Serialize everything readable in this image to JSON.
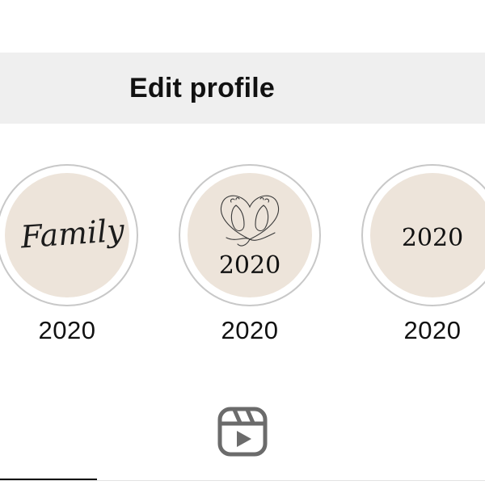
{
  "header": {
    "edit_profile_label": "Edit profile"
  },
  "highlights": [
    {
      "cover_text": "Family",
      "label": "2020"
    },
    {
      "cover_text": "2020",
      "label": "2020"
    },
    {
      "cover_text": "2020",
      "label": "2020"
    }
  ],
  "colors": {
    "cover_background": "#ede4da",
    "ring": "#c8c8c8",
    "edit_bar": "#efefef"
  },
  "icons": {
    "reels_tab": "reels-icon",
    "feet_heart": "baby-feet-heart-icon"
  }
}
